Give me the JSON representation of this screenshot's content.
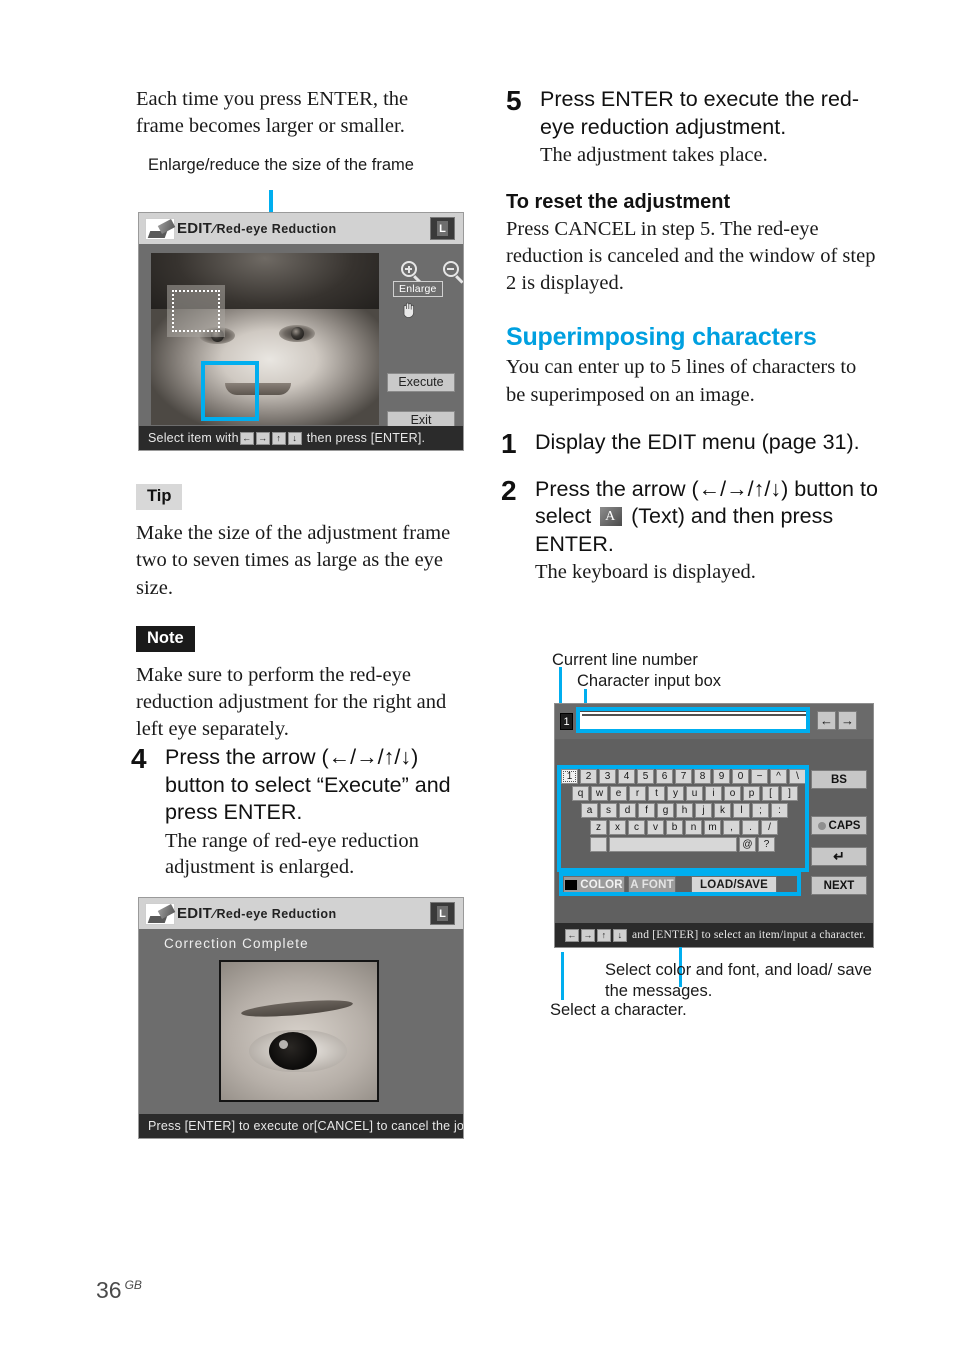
{
  "page": {
    "number": "36",
    "region": "GB"
  },
  "left_column": {
    "intro_text": "Each time you press ENTER, the frame becomes larger or smaller.",
    "callout_frame": "Enlarge/reduce the size of the frame",
    "tip": {
      "badge": "Tip",
      "text": "Make the size of the adjustment frame two to seven times as large as the eye size."
    },
    "note": {
      "badge": "Note",
      "text": "Make sure to perform the red-eye reduction adjustment for the right and left eye separately."
    },
    "step4": {
      "number": "4",
      "heading": "Press the arrow (←/→/↑/↓) button to select “Execute” and press ENTER.",
      "sub": "The range of red-eye reduction adjustment is enlarged."
    }
  },
  "right_column": {
    "step5": {
      "number": "5",
      "heading": "Press ENTER to execute the red-eye reduction adjustment.",
      "sub": "The adjustment takes place."
    },
    "reset": {
      "heading": "To reset the adjustment",
      "text": "Press CANCEL in step 5.  The red-eye reduction is canceled and the window of step 2 is displayed."
    },
    "section": {
      "title": "Superimposing characters",
      "intro": "You can enter up to 5 lines of characters to be superimposed on an image."
    },
    "step1": {
      "number": "1",
      "heading": "Display the EDIT menu (page 31)."
    },
    "step2": {
      "number": "2",
      "heading_a": "Press the arrow (←/→/↑/↓) button to select",
      "heading_b": "(Text) and then press ENTER.",
      "sub": "The keyboard is displayed."
    }
  },
  "screenshot_redeye": {
    "title_main": "EDIT",
    "title_sep": "∕",
    "title_sub": "Red-eye  Reduction",
    "book_badge": "L",
    "enlarge_label": "Enlarge",
    "execute_label": "Execute",
    "exit_label": "Exit",
    "status_prefix": "Select item with",
    "status_keys": [
      "←",
      "→",
      "↑",
      "↓"
    ],
    "status_suffix": "then press [ENTER]."
  },
  "screenshot_complete": {
    "title_main": "EDIT",
    "title_sep": "∕",
    "title_sub": "Red-eye  Reduction",
    "book_badge": "L",
    "message": "Correction Complete",
    "status": "Press [ENTER] to execute or[CANCEL] to cancel the job."
  },
  "screenshot_keyboard": {
    "line_number": "1",
    "input_value": "",
    "arrow_left": "←",
    "arrow_right": "→",
    "keys": {
      "row1": [
        "1",
        "2",
        "3",
        "4",
        "5",
        "6",
        "7",
        "8",
        "9",
        "0",
        "−",
        "^",
        "\\"
      ],
      "row2": [
        "q",
        "w",
        "e",
        "r",
        "t",
        "y",
        "u",
        "i",
        "o",
        "p",
        "[",
        "]"
      ],
      "row3": [
        "a",
        "s",
        "d",
        "f",
        "g",
        "h",
        "j",
        "k",
        "l",
        ";",
        ":"
      ],
      "row4": [
        "z",
        "x",
        "c",
        "v",
        "b",
        "n",
        "m",
        ",",
        ".",
        "/"
      ],
      "row5_tail": [
        "@",
        "?"
      ]
    },
    "selected_key": "1",
    "options": {
      "color": "COLOR",
      "font": "FONT",
      "font_prefix": "A",
      "load_save": "LOAD/SAVE"
    },
    "side_buttons": {
      "bs": "BS",
      "caps": "CAPS",
      "enter": "↵",
      "next": "NEXT"
    },
    "status": "and [ENTER] to select an item/input a character."
  },
  "callouts": {
    "current_line_number": "Current line number",
    "character_input_box": "Character input box",
    "select_color_font": "Select color and font, and load/ save the messages.",
    "select_character": "Select a character."
  }
}
